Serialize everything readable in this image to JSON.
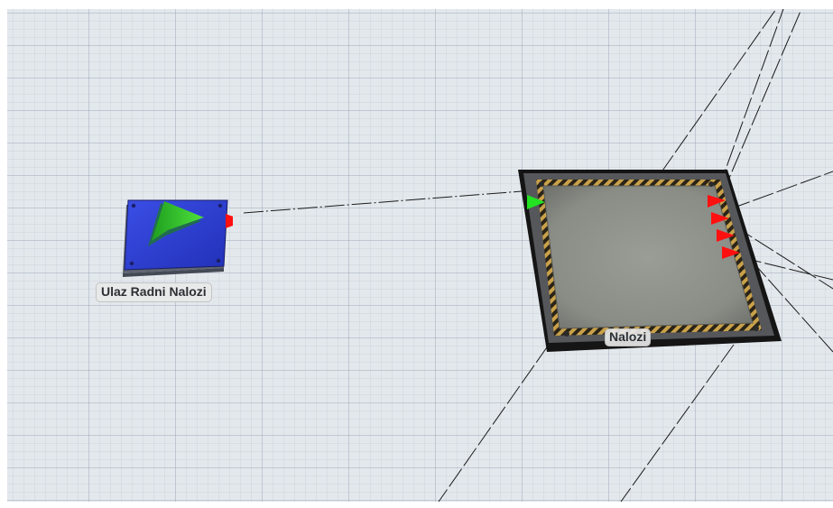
{
  "colors": {
    "grid_background": "#e3e8ed",
    "source_blue": "#2f3fd8",
    "source_green": "#2fcf2a",
    "input_port": "#22e222",
    "output_port": "#ff1010",
    "queue_surface": "#8d8f89",
    "queue_frame": "#1c1c1c",
    "hazard_stripe": "#c9a14a"
  },
  "objects": {
    "source": {
      "label": "Ulaz Radni Nalozi",
      "icon": "source-arrow-icon"
    },
    "queue": {
      "label": "Nalozi",
      "icon": "queue-pad-icon"
    }
  }
}
